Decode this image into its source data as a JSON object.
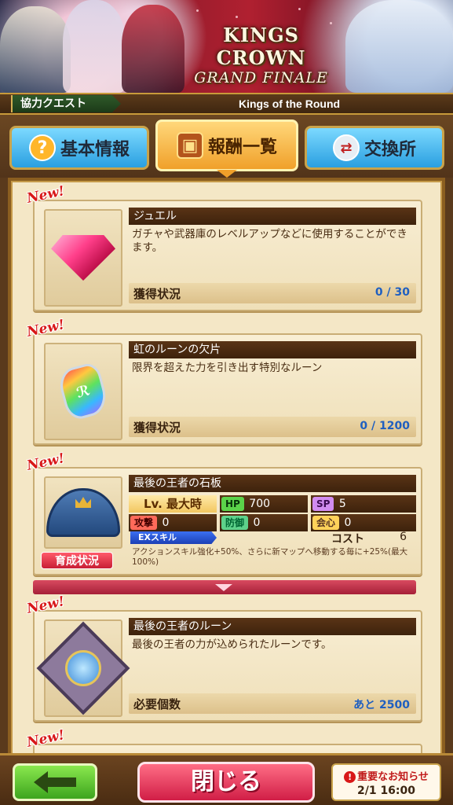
{
  "banner": {
    "logo_line1": "KINGS CROWN",
    "logo_line2": "GRAND FINALE"
  },
  "quest_bar": {
    "tag": "協力クエスト",
    "title": "Kings of the Round"
  },
  "tabs": [
    {
      "label": "基本情報",
      "icon": "question-icon",
      "active": false
    },
    {
      "label": "報酬一覧",
      "icon": "treasure-chest-icon",
      "active": true
    },
    {
      "label": "交換所",
      "icon": "exchange-icon",
      "active": false
    }
  ],
  "rewards": [
    {
      "badge": "New!",
      "name": "ジュエル",
      "description": "ガチャや武器庫のレベルアップなどに使用することができます。",
      "status_label": "獲得状況",
      "status_value": "0 / 30",
      "icon": "jewel-icon"
    },
    {
      "badge": "New!",
      "name": "虹のルーンの欠片",
      "description": "限界を超えた力を引き出す特別なルーン",
      "status_label": "獲得状況",
      "status_value": "0 / 1200",
      "icon": "rainbow-rune-shard-icon"
    },
    {
      "badge": "New!",
      "name": "最後の王者の石板",
      "icon": "stone-tablet-icon",
      "level_label": "Lv. 最大時",
      "hp_label": "HP",
      "hp_value": "700",
      "sp_label": "SP",
      "sp_value": "5",
      "atk_label": "攻撃",
      "atk_value": "0",
      "def_label": "防御",
      "def_value": "0",
      "crit_label": "会心",
      "crit_value": "0",
      "ex_skill_label": "EXスキル",
      "cost_label": "コスト",
      "cost_value": "6",
      "ex_description": "アクションスキル強化+50%、さらに新マップへ移動する毎に+25%(最大100%)",
      "grow_button": "育成状況"
    },
    {
      "badge": "New!",
      "name": "最後の王者のルーン",
      "description": "最後の王者の力が込められたルーンです。",
      "status_label": "必要個数",
      "status_value": "あと 2500",
      "icon": "king-rune-icon"
    },
    {
      "badge": "New!"
    }
  ],
  "bottom": {
    "close_label": "閉じる",
    "notice_title": "重要なお知らせ",
    "notice_date": "2/1 16:00"
  }
}
